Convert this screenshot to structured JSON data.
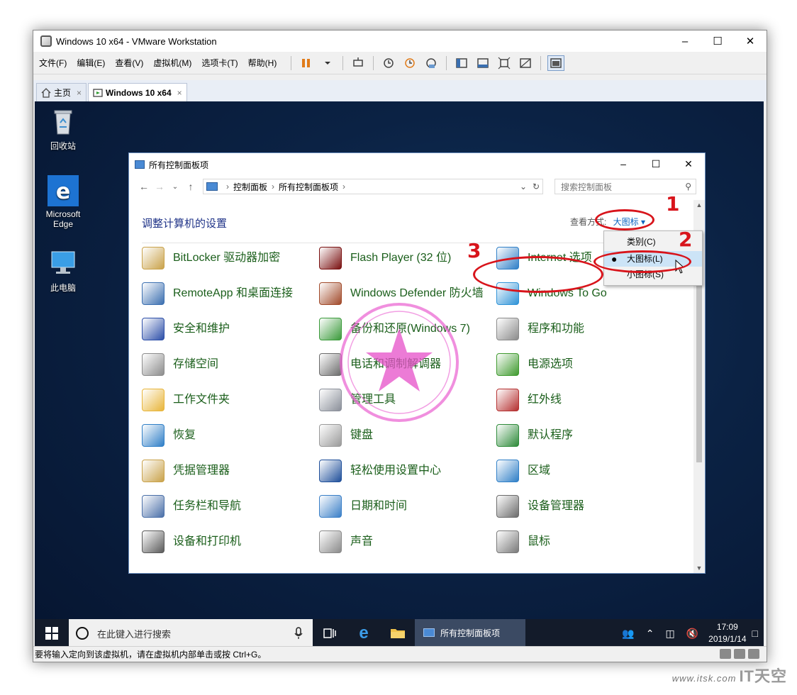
{
  "vmware": {
    "title": "Windows 10 x64 - VMware Workstation",
    "menu": [
      "文件(F)",
      "编辑(E)",
      "查看(V)",
      "虚拟机(M)",
      "选项卡(T)",
      "帮助(H)"
    ],
    "tabs": [
      {
        "label": "主页",
        "close": "×"
      },
      {
        "label": "Windows 10 x64",
        "close": "×"
      }
    ],
    "status_text": "要将输入定向到该虚拟机，请在虚拟机内部单击或按 Ctrl+G。"
  },
  "desktop": {
    "icons": [
      {
        "label": "回收站"
      },
      {
        "label": "Microsoft Edge"
      },
      {
        "label": "此电脑"
      }
    ]
  },
  "control_panel": {
    "title": "所有控制面板项",
    "breadcrumb": [
      "控制面板",
      "所有控制面板项"
    ],
    "search_placeholder": "搜索控制面板",
    "heading": "调整计算机的设置",
    "view_by_label": "查看方式:",
    "view_by_value": "大图标 ▾",
    "view_menu": [
      {
        "label": "类别(C)",
        "selected": false
      },
      {
        "label": "大图标(L)",
        "selected": true
      },
      {
        "label": "小图标(S)",
        "selected": false
      }
    ],
    "items": [
      {
        "label": "BitLocker 驱动器加密",
        "icon": "bitlocker-icon",
        "color": "#c9a24a"
      },
      {
        "label": "Flash Player (32 位)",
        "icon": "flash-player-icon",
        "color": "#7a1010"
      },
      {
        "label": "Internet 选项",
        "icon": "internet-options-icon",
        "color": "#2f7fc7"
      },
      {
        "label": "RemoteApp 和桌面连接",
        "icon": "remoteapp-icon",
        "color": "#3b6fb0"
      },
      {
        "label": "Windows Defender 防火墙",
        "icon": "firewall-icon",
        "color": "#a14a2a"
      },
      {
        "label": "Windows To Go",
        "icon": "windows-to-go-icon",
        "color": "#2f93d7"
      },
      {
        "label": "安全和维护",
        "icon": "security-flag-icon",
        "color": "#2c4ea8"
      },
      {
        "label": "备份和还原(Windows 7)",
        "icon": "backup-icon",
        "color": "#3a9a3a"
      },
      {
        "label": "程序和功能",
        "icon": "programs-icon",
        "color": "#8a8a8a"
      },
      {
        "label": "存储空间",
        "icon": "storage-spaces-icon",
        "color": "#8c8c8c"
      },
      {
        "label": "电话和调制解调器",
        "icon": "phone-modem-icon",
        "color": "#6b6b6b"
      },
      {
        "label": "电源选项",
        "icon": "power-options-icon",
        "color": "#3f9a2e"
      },
      {
        "label": "工作文件夹",
        "icon": "work-folders-icon",
        "color": "#e8b53a"
      },
      {
        "label": "管理工具",
        "icon": "admin-tools-icon",
        "color": "#8a8f99"
      },
      {
        "label": "红外线",
        "icon": "infrared-icon",
        "color": "#b53030"
      },
      {
        "label": "恢复",
        "icon": "recovery-icon",
        "color": "#2f7fc7"
      },
      {
        "label": "键盘",
        "icon": "keyboard-icon",
        "color": "#9a9a9a"
      },
      {
        "label": "默认程序",
        "icon": "default-programs-icon",
        "color": "#2e8b3a"
      },
      {
        "label": "凭据管理器",
        "icon": "credential-manager-icon",
        "color": "#c9a24a"
      },
      {
        "label": "轻松使用设置中心",
        "icon": "ease-of-access-icon",
        "color": "#1f4f9a"
      },
      {
        "label": "区域",
        "icon": "region-icon",
        "color": "#2f7fc7"
      },
      {
        "label": "任务栏和导航",
        "icon": "taskbar-navigation-icon",
        "color": "#4a6fa8"
      },
      {
        "label": "日期和时间",
        "icon": "date-time-icon",
        "color": "#3a7fc7"
      },
      {
        "label": "设备管理器",
        "icon": "device-manager-icon",
        "color": "#6b6b6b"
      },
      {
        "label": "设备和打印机",
        "icon": "devices-printers-icon",
        "color": "#5a5a5a"
      },
      {
        "label": "声音",
        "icon": "sound-icon",
        "color": "#8a8a8a"
      },
      {
        "label": "鼠标",
        "icon": "mouse-icon",
        "color": "#7a7a7a"
      }
    ]
  },
  "annotations": {
    "step1": "1",
    "step2": "2",
    "step3": "3"
  },
  "taskbar": {
    "search_placeholder": "在此键入进行搜索",
    "open_window": "所有控制面板项",
    "time": "17:09",
    "date": "2019/1/14"
  },
  "watermark": {
    "site": "www.itsk.com",
    "brand": "IT天空"
  }
}
